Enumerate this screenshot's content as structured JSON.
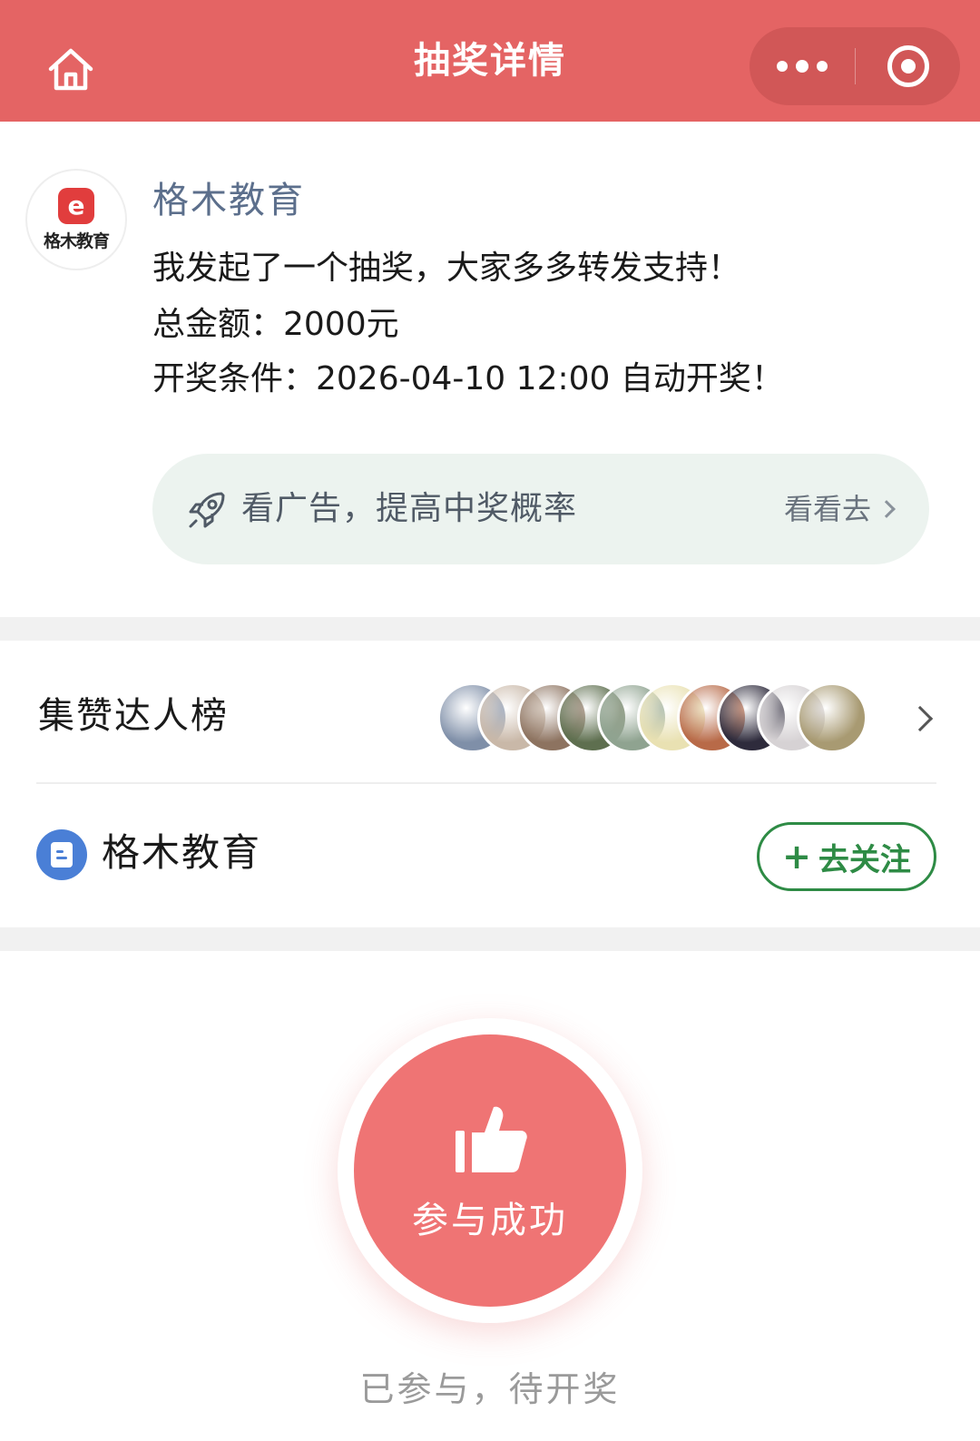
{
  "header": {
    "title": "抽奖详情",
    "home_icon": "home-icon",
    "more_icon": "more-dots-icon",
    "close_icon": "target-circle-icon",
    "bg_color": "#e46464"
  },
  "post": {
    "author": "格木教育",
    "avatar_logo_mark": "e",
    "avatar_logo_text": "格木教育",
    "line1": "我发起了一个抽奖，大家多多转发支持！",
    "line2": "总金额：2000元",
    "line3": "开奖条件：2026-04-10 12:00 自动开奖！"
  },
  "ad": {
    "icon": "rocket-icon",
    "text": "看广告，提高中奖概率",
    "link": "看看去"
  },
  "leaderboard": {
    "label": "集赞达人榜",
    "avatars": [
      {
        "color": "#7f8fa8"
      },
      {
        "color": "#c9b8a8"
      },
      {
        "color": "#8d7360"
      },
      {
        "color": "#5e6f4f"
      },
      {
        "color": "#8fa390"
      },
      {
        "color": "#e9e1b2"
      },
      {
        "color": "#b86a48"
      },
      {
        "color": "#2e2b3c"
      },
      {
        "color": "#d6d2d4"
      },
      {
        "color": "#a89a72"
      }
    ]
  },
  "account": {
    "icon": "official-account-icon",
    "name": "格木教育",
    "follow_plus": "+",
    "follow_label": "去关注",
    "accent": "#2e8b45"
  },
  "action": {
    "icon": "thumbs-up-icon",
    "label": "参与成功",
    "status": "已参与，待开奖",
    "color": "#ef7474"
  }
}
